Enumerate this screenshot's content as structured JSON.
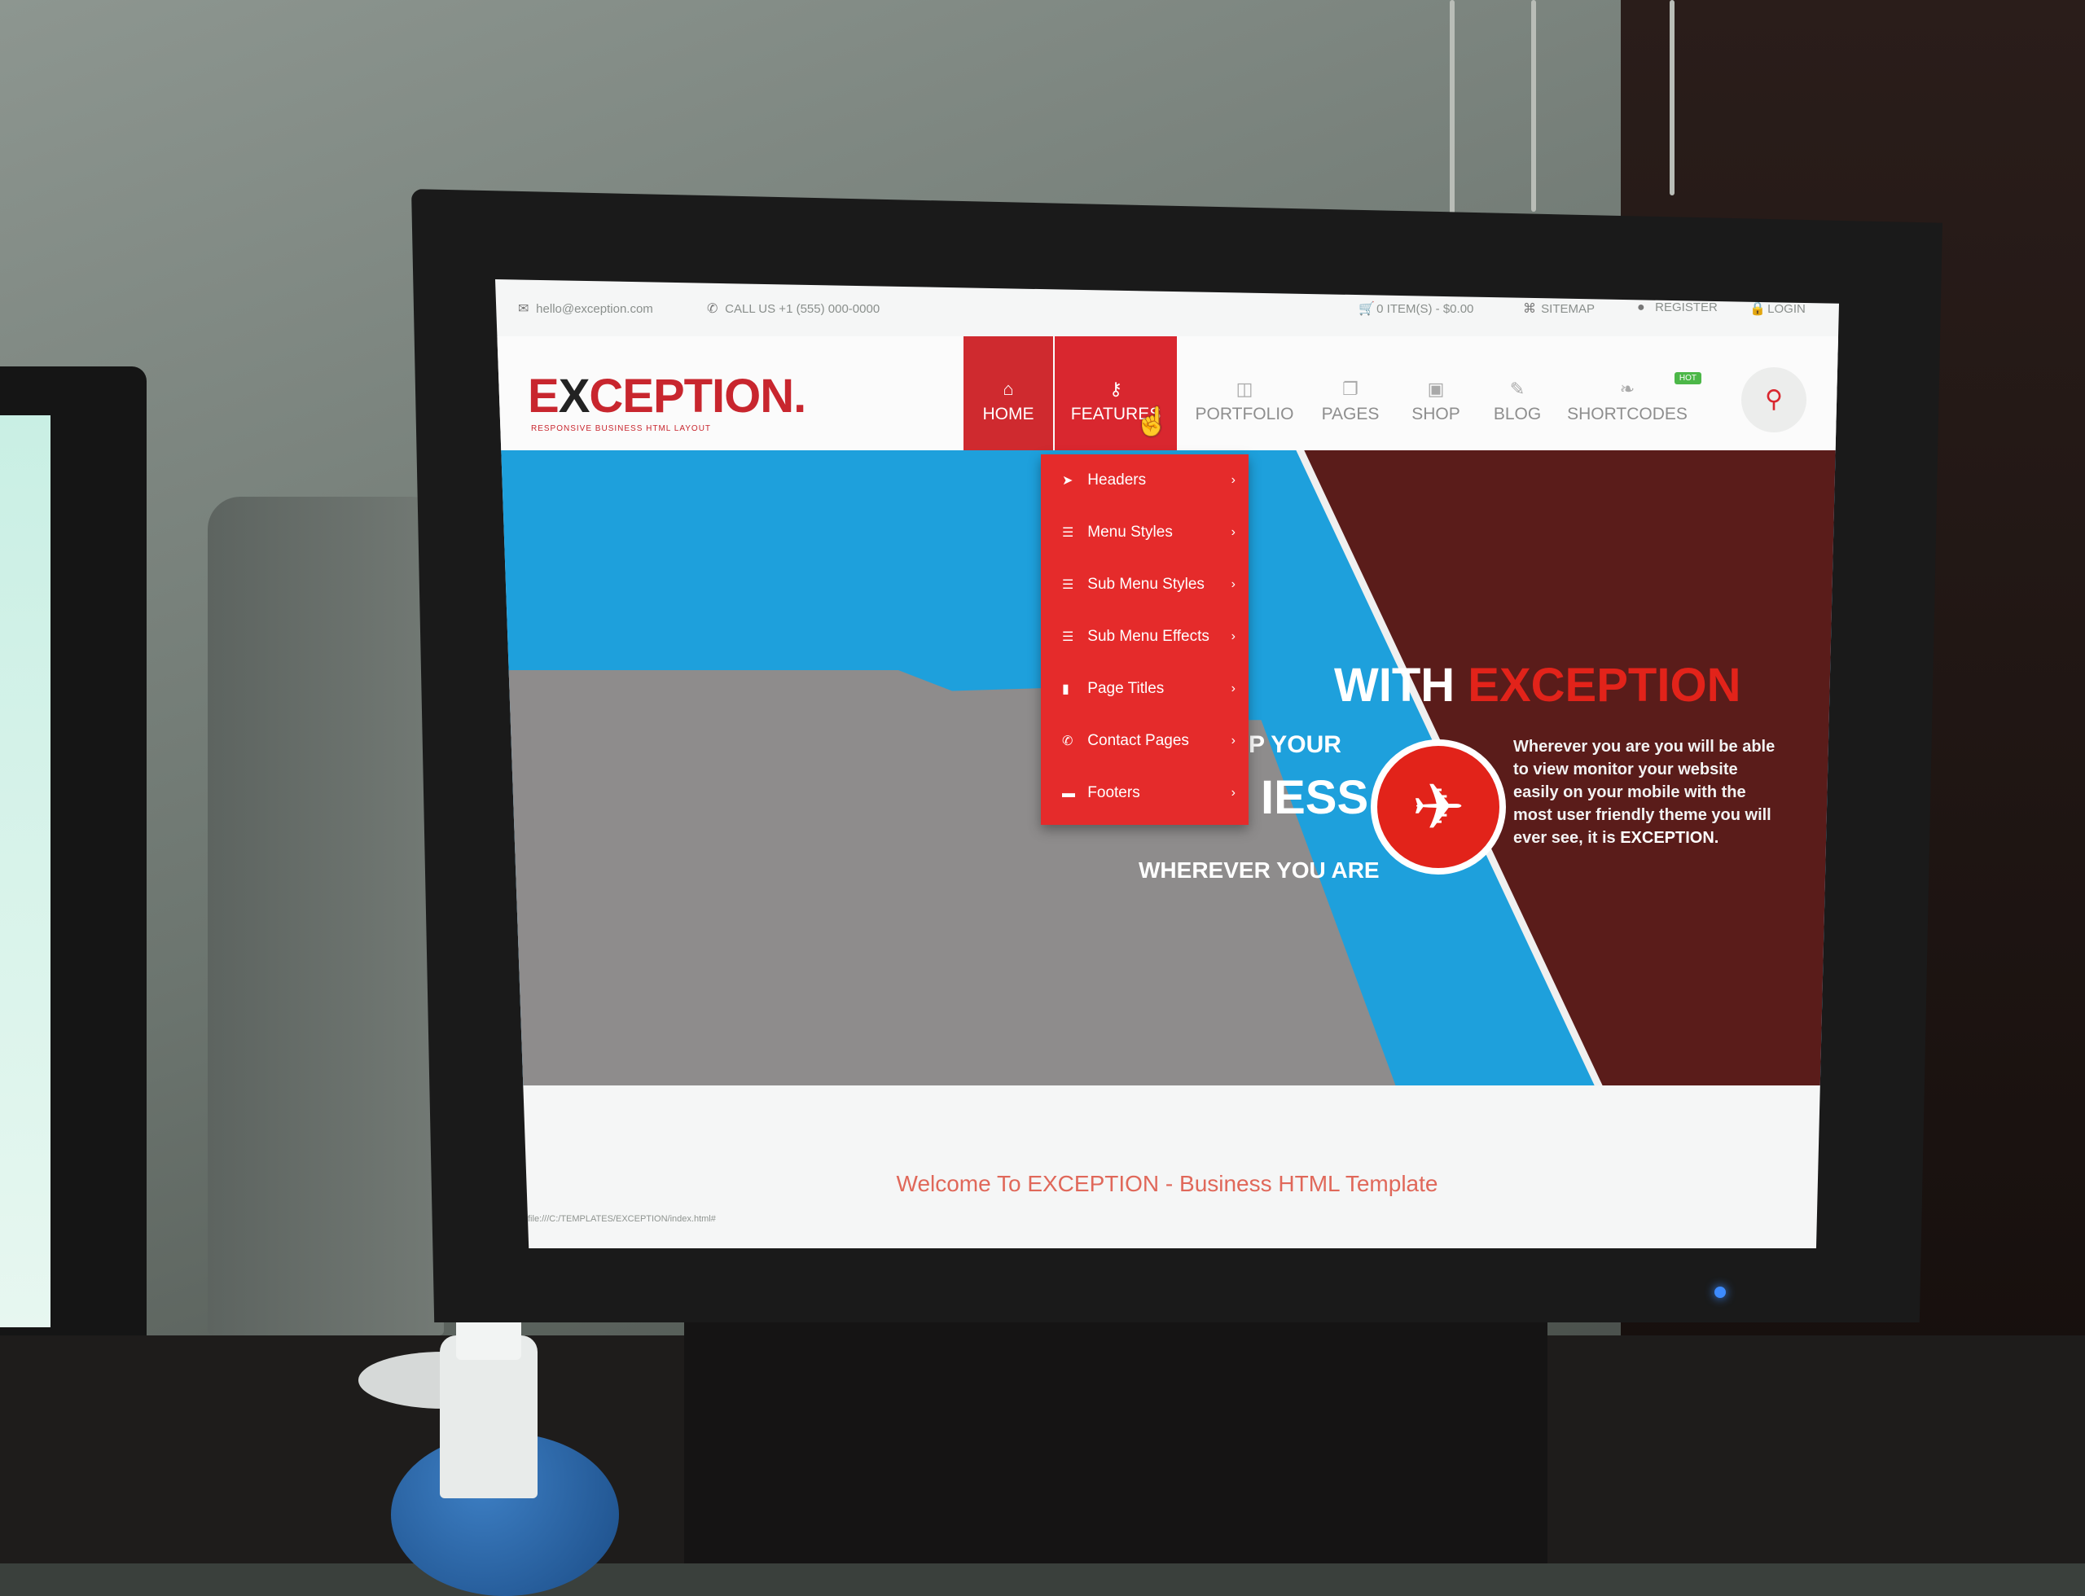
{
  "topbar": {
    "email": "hello@exception.com",
    "phone": "CALL US +1 (555) 000-0000",
    "cart": "0 ITEM(S) - $0.00",
    "sitemap": "SITEMAP",
    "register": "REGISTER",
    "login": "LOGIN"
  },
  "logo": {
    "text_pre": "E",
    "text_x": "X",
    "text_post": "CEPTION.",
    "tagline": "RESPONSIVE BUSINESS HTML LAYOUT"
  },
  "nav": [
    {
      "label": "HOME",
      "icon": "home-icon"
    },
    {
      "label": "FEATURES",
      "icon": "key-icon"
    },
    {
      "label": "PORTFOLIO",
      "icon": "portfolio-icon"
    },
    {
      "label": "PAGES",
      "icon": "pages-icon"
    },
    {
      "label": "SHOP",
      "icon": "shop-icon"
    },
    {
      "label": "BLOG",
      "icon": "blog-icon"
    },
    {
      "label": "SHORTCODES",
      "icon": "leaf-icon",
      "badge": "HOT"
    }
  ],
  "dropdown": [
    {
      "label": "Headers",
      "icon": "paper-plane-icon"
    },
    {
      "label": "Menu Styles",
      "icon": "bars-icon"
    },
    {
      "label": "Sub Menu Styles",
      "icon": "bars-icon"
    },
    {
      "label": "Sub Menu Effects",
      "icon": "bars-icon"
    },
    {
      "label": "Page Titles",
      "icon": "bookmark-icon"
    },
    {
      "label": "Contact Pages",
      "icon": "phone-icon"
    },
    {
      "label": "Footers",
      "icon": "footer-icon"
    }
  ],
  "hero": {
    "title_white": "WITH",
    "title_red": "EXCEPTION",
    "left_line1": "P YOUR",
    "left_line2": "IESS",
    "left_line3": "WHEREVER YOU ARE",
    "text_main": "Wherever you are you will be able to view monitor your website easily on your mobile with the most user friendly theme you will ever see, it is",
    "text_strong": "EXCEPTION."
  },
  "welcome": "Welcome To EXCEPTION - Business HTML Template",
  "status_url": "file:///C:/TEMPLATES/EXCEPTION/index.html#",
  "colors": {
    "brand_red": "#d9272f",
    "hero_blue": "#1ea0dc",
    "hero_dark": "#5a1c1a",
    "dropdown_red": "#e52b2b"
  }
}
